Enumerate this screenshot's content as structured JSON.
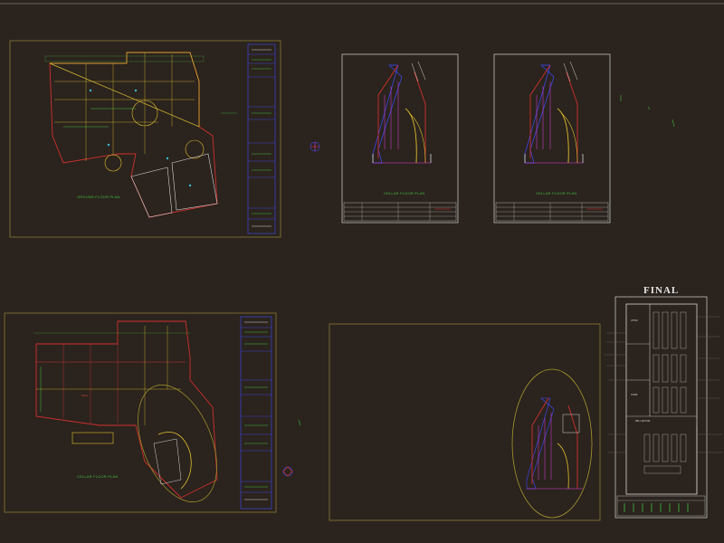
{
  "colors": {
    "background": "#2b231d",
    "sheet_border": "#8a7a3a",
    "white_border": "#d6d6d6",
    "wall_red": "#d0302e",
    "wall_yellow": "#e0c030",
    "line_blue": "#3c4cff",
    "line_green": "#3fbf3f",
    "line_magenta": "#e040e0",
    "line_cyan": "#38c0d8"
  },
  "drawings": {
    "ground_floor": {
      "label": "GROUND FLOOR PLAN"
    },
    "cellar_floor": {
      "label": "CELLAR FLOOR PLAN"
    },
    "cellar_copy_1": {
      "label": "CELLAR FLOOR PLAN"
    },
    "cellar_copy_2": {
      "label": "CELLAR FLOOR PLAN"
    },
    "final": {
      "label": "FINAL"
    },
    "final_room_1": {
      "label": "OFFICE"
    },
    "final_room_2": {
      "label": "STORE"
    },
    "final_room_3": {
      "label": "WELL SECTION"
    }
  }
}
